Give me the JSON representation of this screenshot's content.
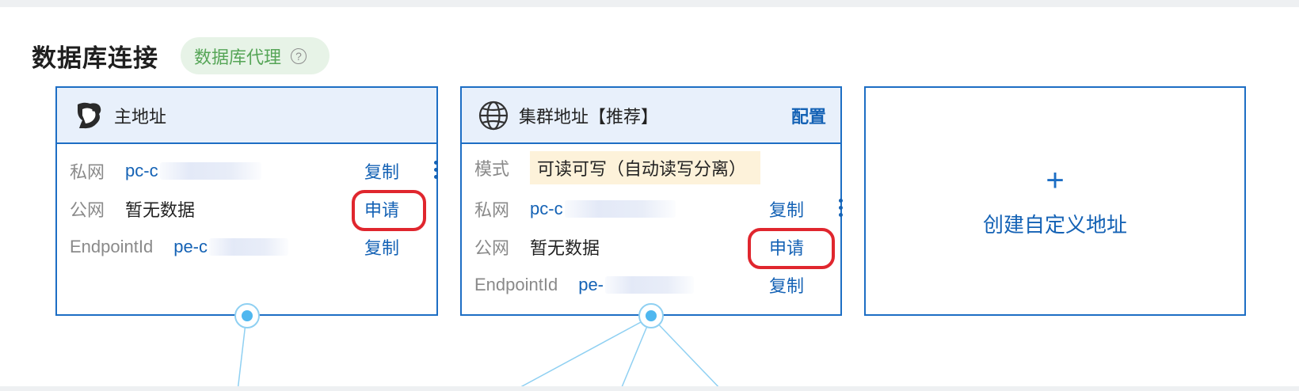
{
  "header": {
    "title": "数据库连接",
    "proxy_label": "数据库代理",
    "help_glyph": "?"
  },
  "cards": [
    {
      "title": "主地址",
      "icon": "bear-logo-icon",
      "rows": [
        {
          "label": "私网",
          "value": "pc-c",
          "action": "复制",
          "has_more": true
        },
        {
          "label": "公网",
          "value": "暂无数据",
          "action": "申请"
        },
        {
          "label": "EndpointId",
          "value": "pe-c",
          "action": "复制"
        }
      ]
    },
    {
      "title": "集群地址【推荐】",
      "icon": "globe-icon",
      "config_label": "配置",
      "mode_label": "模式",
      "mode_value": "可读可写（自动读写分离）",
      "rows": [
        {
          "label": "私网",
          "value": "pc-c",
          "action": "复制",
          "has_more": true
        },
        {
          "label": "公网",
          "value": "暂无数据",
          "action": "申请"
        },
        {
          "label": "EndpointId",
          "value": "pe-",
          "action": "复制"
        }
      ]
    }
  ],
  "create_card": {
    "plus": "+",
    "label": "创建自定义地址"
  },
  "colors": {
    "accent": "#1d6ec4",
    "link": "#1462b5",
    "proxy_bg": "#e7f3e7",
    "proxy_text": "#56a557",
    "mode_bg": "#fdf2da",
    "highlight": "#e0262e"
  }
}
